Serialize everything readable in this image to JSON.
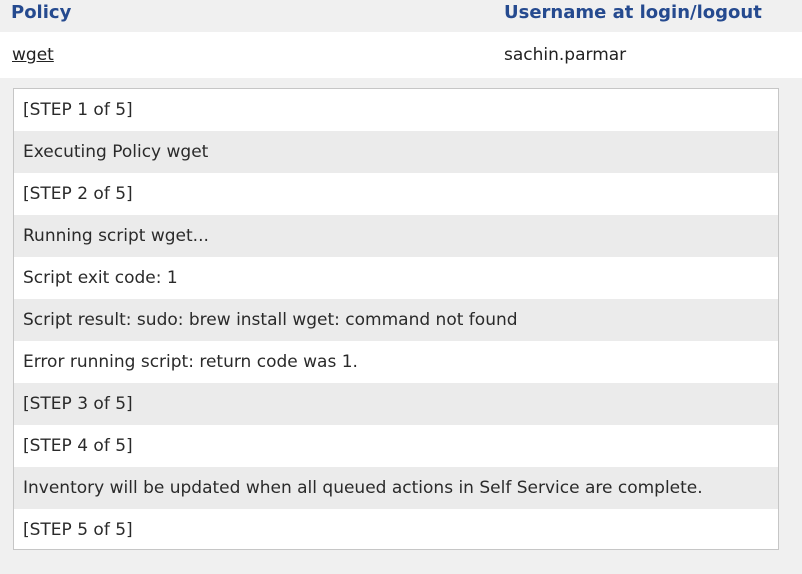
{
  "table": {
    "headers": {
      "policy": "Policy",
      "username": "Username at login/logout"
    },
    "row": {
      "policy": "wget",
      "username": "sachin.parmar"
    }
  },
  "log": [
    "[STEP 1 of 5]",
    "Executing Policy wget",
    "[STEP 2 of 5]",
    "Running script wget...",
    "Script exit code: 1",
    "Script result: sudo: brew install wget: command not found",
    "Error running script: return code was 1.",
    "[STEP 3 of 5]",
    "[STEP 4 of 5]",
    "Inventory will be updated when all queued actions in Self Service are complete.",
    "[STEP 5 of 5]"
  ]
}
